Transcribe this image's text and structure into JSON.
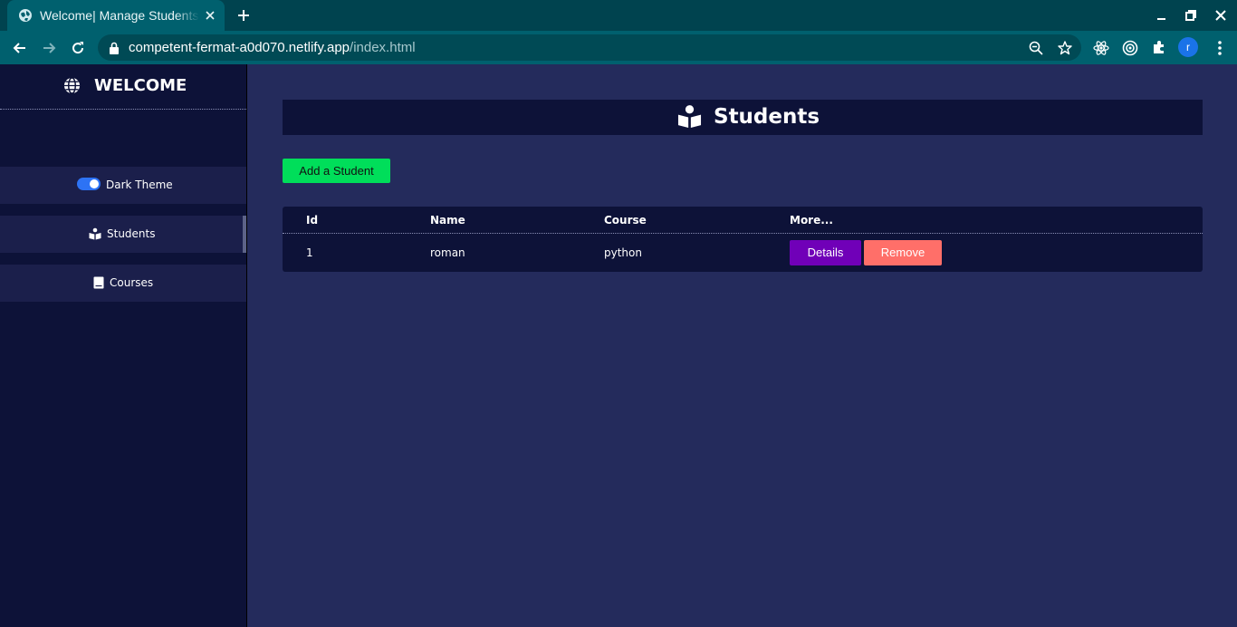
{
  "browser": {
    "tab": {
      "title": "Welcome| Manage Students"
    },
    "address": {
      "host": "competent-fermat-a0d070.netlify.app",
      "path": "/index.html"
    },
    "profile_initial": "r"
  },
  "sidebar": {
    "brand": "WELCOME",
    "items": [
      {
        "label": "Dark Theme",
        "icon": "toggle-switch"
      },
      {
        "label": "Students",
        "icon": "reader-icon"
      },
      {
        "label": "Courses",
        "icon": "book-icon"
      }
    ]
  },
  "main": {
    "title": "Students",
    "title_icon": "reader-icon",
    "add_button": "Add a Student",
    "table": {
      "headers": [
        "Id",
        "Name",
        "Course",
        "More..."
      ],
      "rows": [
        {
          "id": "1",
          "name": "roman",
          "course": "python",
          "details": "Details",
          "remove": "Remove"
        }
      ]
    }
  },
  "colors": {
    "sidebar_bg": "#0d1238",
    "main_bg": "#242b5c",
    "add_button": "#00de5a",
    "details_button": "#7000b8",
    "remove_button": "#ff6f69",
    "toggle_on": "#2d73f5"
  }
}
